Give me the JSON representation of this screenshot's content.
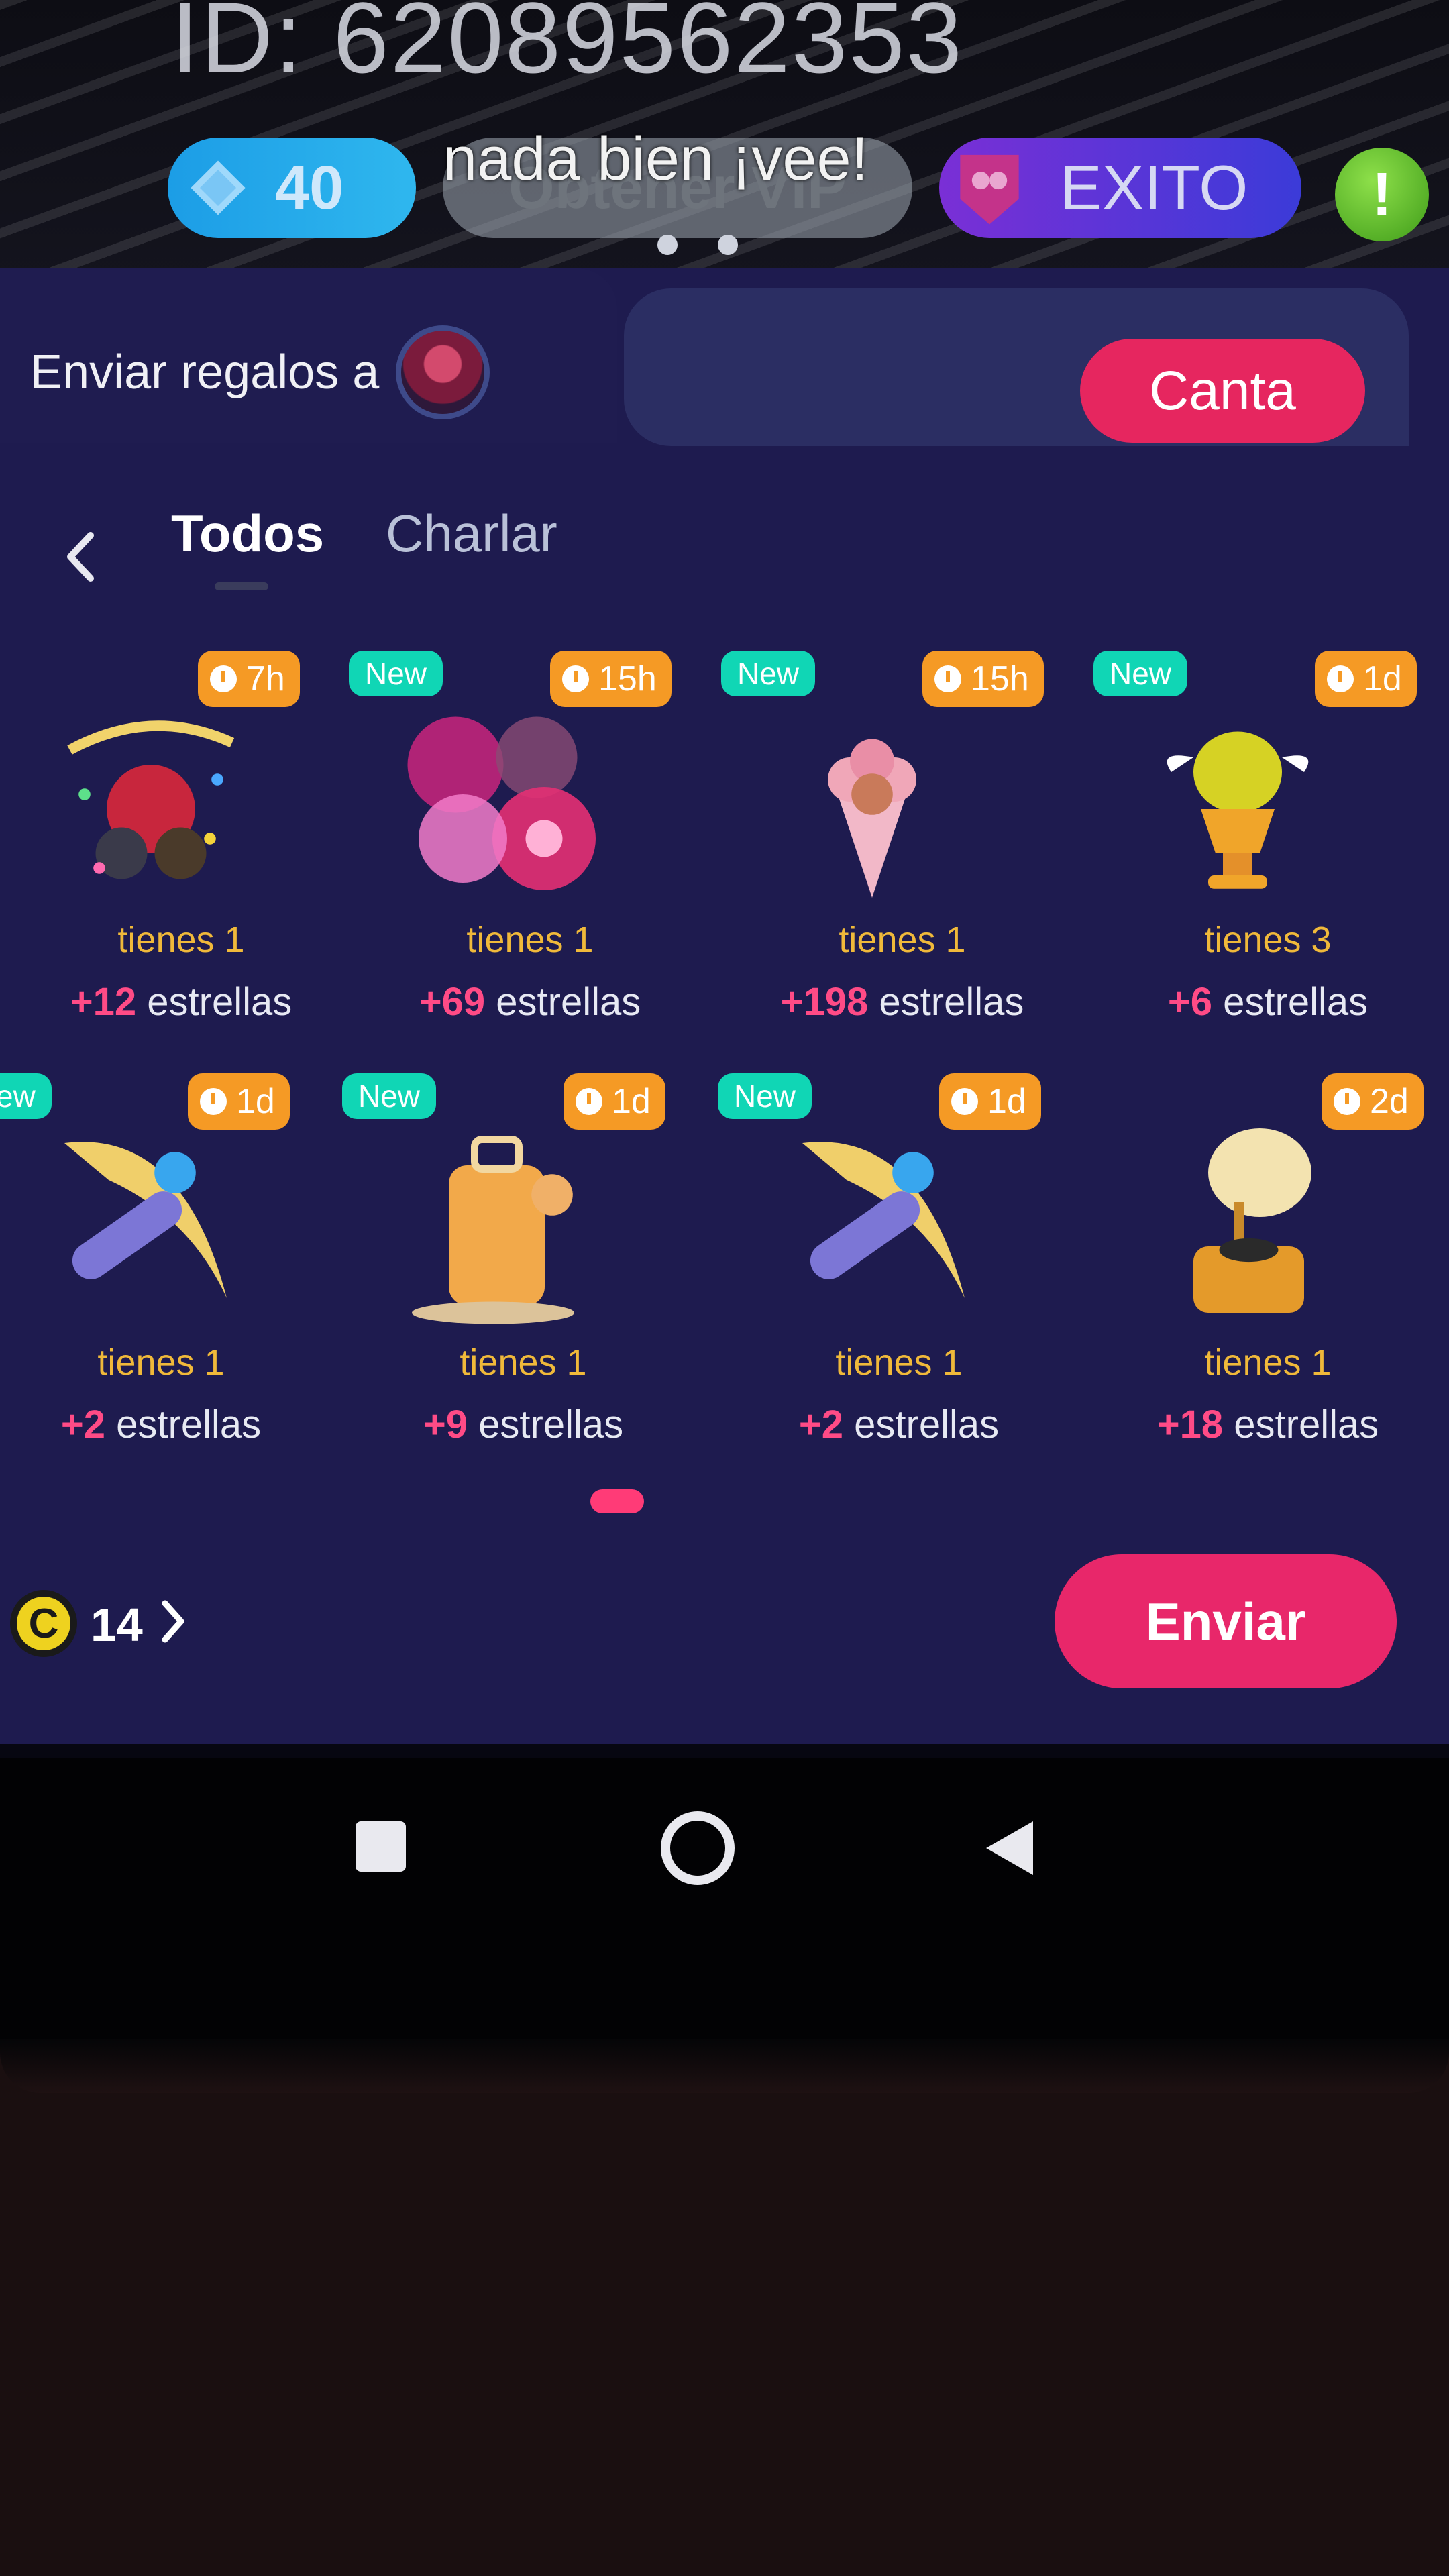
{
  "room": {
    "id_text": "ID: 62089562353",
    "gems_count": "40",
    "vip_label": "Obtener VIP",
    "overlay_message": "nada  bien ¡vee!",
    "exito_label": "EXITO",
    "green_badge": "!"
  },
  "gift_panel": {
    "send_to_label": "Enviar regalos a",
    "canta_button": "Canta",
    "tabs": [
      {
        "label": "Todos",
        "active": true
      },
      {
        "label": "Charlar",
        "active": false
      }
    ],
    "gifts": [
      {
        "name": "party-gift",
        "new": false,
        "new_label": "",
        "time": "7h",
        "owned": "tienes 1",
        "stars_value": "+12",
        "stars_label": "estrellas"
      },
      {
        "name": "fireworks-gift",
        "new": true,
        "new_label": "New",
        "time": "15h",
        "owned": "tienes 1",
        "stars_value": "+69",
        "stars_label": "estrellas"
      },
      {
        "name": "bouquet-gift",
        "new": true,
        "new_label": "New",
        "time": "15h",
        "owned": "tienes 1",
        "stars_value": "+198",
        "stars_label": "estrellas"
      },
      {
        "name": "trophy-gift",
        "new": true,
        "new_label": "New",
        "time": "1d",
        "owned": "tienes 3",
        "stars_value": "+6",
        "stars_label": "estrellas"
      },
      {
        "name": "pickaxe-gift",
        "new": true,
        "new_label": "ew",
        "time": "1d",
        "owned": "tienes 1",
        "stars_value": "+2",
        "stars_label": "estrellas"
      },
      {
        "name": "suitcase-gift",
        "new": true,
        "new_label": "New",
        "time": "1d",
        "owned": "tienes 1",
        "stars_value": "+9",
        "stars_label": "estrellas"
      },
      {
        "name": "pickaxe-gift-2",
        "new": true,
        "new_label": "New",
        "time": "1d",
        "owned": "tienes 1",
        "stars_value": "+2",
        "stars_label": "estrellas"
      },
      {
        "name": "gramophone-gift",
        "new": false,
        "new_label": "",
        "time": "2d",
        "owned": "tienes 1",
        "stars_value": "+18",
        "stars_label": "estrellas"
      }
    ],
    "coins": "14",
    "coin_symbol": "C",
    "send_button": "Enviar"
  },
  "colors": {
    "accent_pink": "#e8276a",
    "badge_orange": "#f59a25",
    "badge_new": "#10d6b5",
    "panel_bg": "#1e1b4f"
  },
  "icons": [
    "diamond-icon",
    "group-badge-icon",
    "back-chevron-icon",
    "clock-icon",
    "coin-icon",
    "chevron-right-icon",
    "nav-recent-icon",
    "nav-home-icon",
    "nav-back-icon"
  ]
}
